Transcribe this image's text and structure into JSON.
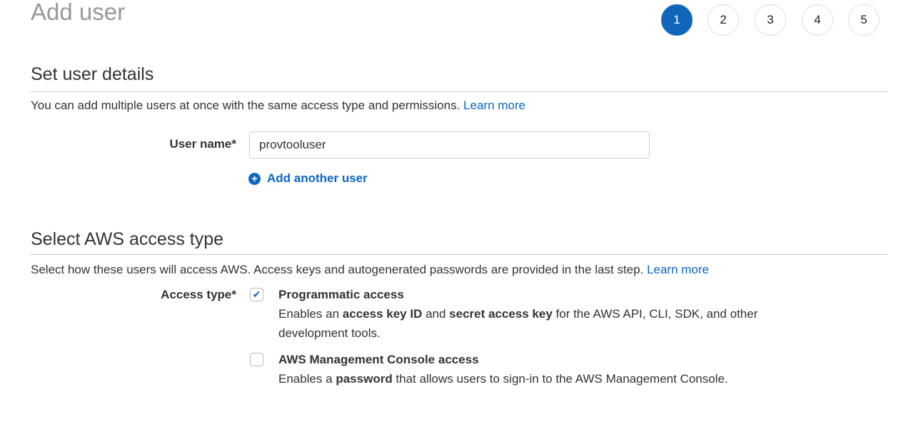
{
  "page": {
    "title": "Add user"
  },
  "steps": [
    {
      "label": "1",
      "active": true
    },
    {
      "label": "2",
      "active": false
    },
    {
      "label": "3",
      "active": false
    },
    {
      "label": "4",
      "active": false
    },
    {
      "label": "5",
      "active": false
    }
  ],
  "details": {
    "heading": "Set user details",
    "description": "You can add multiple users at once with the same access type and permissions.",
    "learn_more": "Learn more",
    "user_name_label": "User name*",
    "user_name_value": "provtooluser",
    "add_another": "Add another user"
  },
  "access": {
    "heading": "Select AWS access type",
    "description": "Select how these users will access AWS. Access keys and autogenerated passwords are provided in the last step.",
    "learn_more": "Learn more",
    "label": "Access type*",
    "options": [
      {
        "title": "Programmatic access",
        "checked": true,
        "desc": [
          "Enables an ",
          "access key ID",
          " and ",
          "secret access key",
          " for the AWS API, CLI, SDK, and other development tools."
        ]
      },
      {
        "title": "AWS Management Console access",
        "checked": false,
        "desc": [
          "Enables a ",
          "password",
          " that allows users to sign-in to the AWS Management Console."
        ]
      }
    ]
  },
  "colors": {
    "accent": "#1166bb",
    "link": "#0b66c3"
  }
}
